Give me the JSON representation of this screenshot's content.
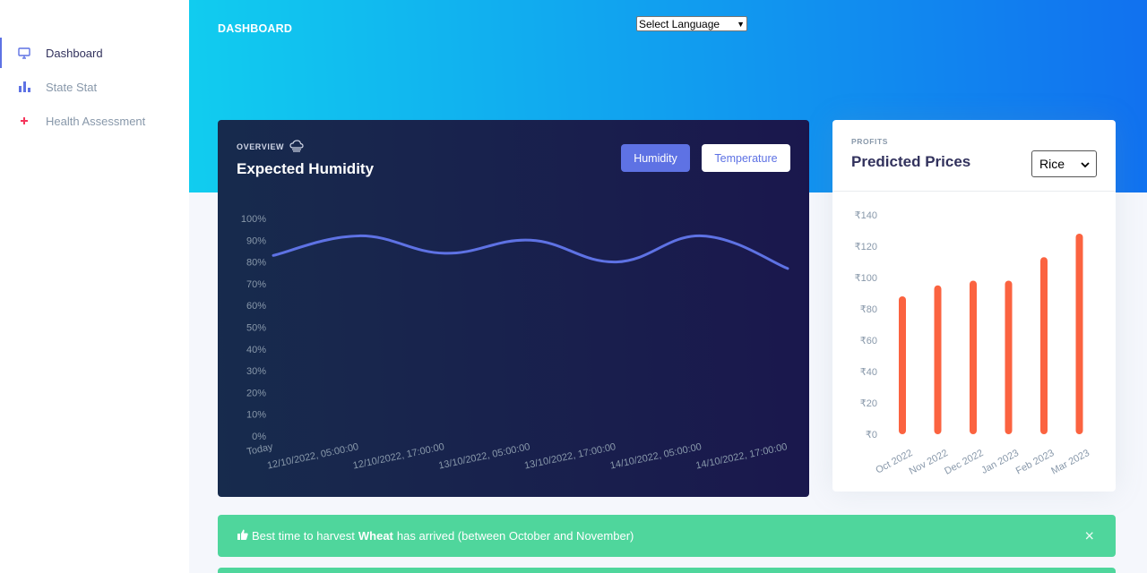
{
  "sidebar": {
    "items": [
      {
        "label": "Dashboard",
        "icon": "monitor-icon",
        "active": true
      },
      {
        "label": "State Stat",
        "icon": "bar-chart-icon",
        "active": false
      },
      {
        "label": "Health Assessment",
        "icon": "plus-icon",
        "active": false
      }
    ]
  },
  "header": {
    "title": "DASHBOARD",
    "language_select": "Select Language"
  },
  "humidity_card": {
    "overline": "OVERVIEW",
    "title": "Expected Humidity",
    "buttons": {
      "humidity": "Humidity",
      "temperature": "Temperature"
    }
  },
  "prices_card": {
    "overline": "PROFITS",
    "title": "Predicted Prices",
    "select_value": "Rice"
  },
  "alert": {
    "prefix": "Best time to harvest",
    "crop": "Wheat",
    "suffix": "has arrived (between October and November)",
    "close": "×"
  },
  "colors": {
    "accent": "#5e72e4",
    "bar": "#fb6340",
    "success": "#4fd69c",
    "header_from": "#11cdef",
    "header_to": "#1171ef"
  },
  "chart_data": [
    {
      "type": "line",
      "x": [
        "Today",
        "12/10/2022, 05:00:00",
        "12/10/2022, 17:00:00",
        "13/10/2022, 05:00:00",
        "13/10/2022, 17:00:00",
        "14/10/2022, 05:00:00",
        "14/10/2022, 17:00:00"
      ],
      "series": [
        {
          "values": [
            83,
            92,
            84,
            90,
            80,
            92,
            77
          ]
        }
      ],
      "yticks": [
        "0%",
        "10%",
        "20%",
        "30%",
        "40%",
        "50%",
        "60%",
        "70%",
        "80%",
        "90%",
        "100%"
      ],
      "ylim": [
        0,
        100
      ],
      "grid": false
    },
    {
      "type": "bar",
      "categories": [
        "Oct 2022",
        "Nov 2022",
        "Dec 2022",
        "Jan 2023",
        "Feb 2023",
        "Mar 2023"
      ],
      "values": [
        88,
        95,
        98,
        98,
        113,
        128
      ],
      "yticks": [
        "₹0",
        "₹20",
        "₹40",
        "₹60",
        "₹80",
        "₹100",
        "₹120",
        "₹140"
      ],
      "ylim": [
        0,
        140
      ],
      "grid": false
    }
  ]
}
